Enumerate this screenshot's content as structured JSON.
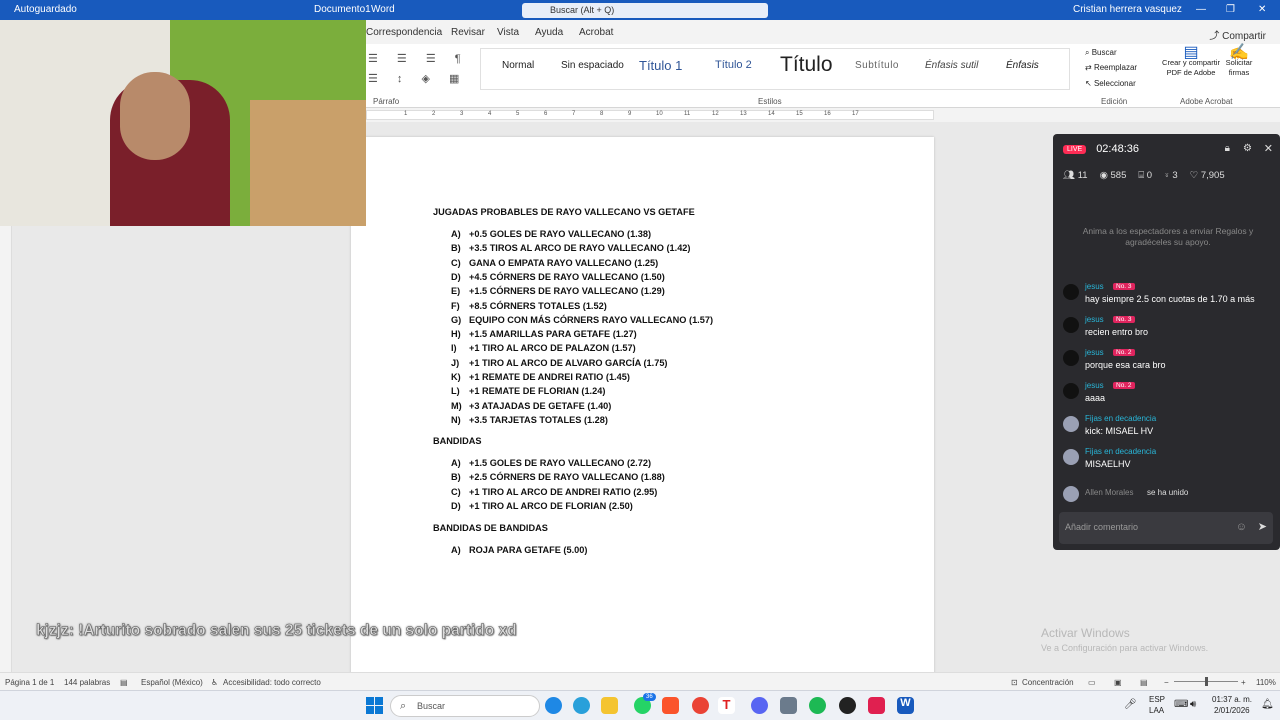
{
  "title_bar": {
    "autosave": "Autoguardado",
    "doc_name": "Documento1",
    "app": "Word",
    "search": "Buscar (Alt + Q)",
    "user": "Cristian herrera vasquez"
  },
  "ribbon_tabs": [
    "Correspondencia",
    "Revisar",
    "Vista",
    "Ayuda",
    "Acrobat"
  ],
  "share_label": "Compartir",
  "styles": [
    "Normal",
    "Sin espaciado",
    "Título 1",
    "Título 2",
    "Título",
    "Subtítulo",
    "Énfasis sutil",
    "Énfasis"
  ],
  "groups": {
    "parrafo": "Párrafo",
    "estilos": "Estilos",
    "edicion": "Edición",
    "adobe": "Adobe Acrobat"
  },
  "editing": {
    "buscar": "Buscar",
    "reemplazar": "Reemplazar",
    "seleccionar": "Seleccionar"
  },
  "adobe": {
    "create": "Crear y compartir PDF de Adobe",
    "sign": "Solicitar firmas"
  },
  "document": {
    "heading1": "JUGADAS PROBABLES DE RAYO VALLECANO VS GETAFE",
    "list1": [
      {
        "l": "A)",
        "t": "+0.5 GOLES DE RAYO VALLECANO (1.38)"
      },
      {
        "l": "B)",
        "t": "+3.5 TIROS AL ARCO DE RAYO VALLECANO (1.42)"
      },
      {
        "l": "C)",
        "t": "GANA O EMPATA RAYO VALLECANO (1.25)"
      },
      {
        "l": "D)",
        "t": "+4.5 CÓRNERS DE RAYO VALLECANO (1.50)"
      },
      {
        "l": "E)",
        "t": "+1.5 CÓRNERS DE RAYO VALLECANO (1.29)"
      },
      {
        "l": "F)",
        "t": "+8.5 CÓRNERS TOTALES (1.52)"
      },
      {
        "l": "G)",
        "t": "EQUIPO CON MÁS CÓRNERS RAYO VALLECANO (1.57)"
      },
      {
        "l": "H)",
        "t": "+1.5 AMARILLAS PARA GETAFE (1.27)"
      },
      {
        "l": "I)",
        "t": "+1 TIRO AL ARCO DE PALAZON (1.57)"
      },
      {
        "l": "J)",
        "t": "+1 TIRO AL ARCO DE ALVARO GARCÍA (1.75)"
      },
      {
        "l": "K)",
        "t": "+1 REMATE DE ANDREI RATIO (1.45)"
      },
      {
        "l": "L)",
        "t": "+1 REMATE DE FLORIAN (1.24)"
      },
      {
        "l": "M)",
        "t": "+3 ATAJADAS DE GETAFE (1.40)"
      },
      {
        "l": "N)",
        "t": "+3.5 TARJETAS TOTALES (1.28)"
      }
    ],
    "heading2": "BANDIDAS",
    "list2": [
      {
        "l": "A)",
        "t": "+1.5 GOLES DE RAYO VALLECANO (2.72)"
      },
      {
        "l": "B)",
        "t": "+2.5 CÓRNERS DE RAYO VALLECANO (1.88)"
      },
      {
        "l": "C)",
        "t": "+1 TIRO AL ARCO DE ANDREI RATIO (2.95)"
      },
      {
        "l": "D)",
        "t": "+1 TIRO AL ARCO DE FLORIAN (2.50)"
      }
    ],
    "heading3": "BANDIDAS DE BANDIDAS",
    "list3": [
      {
        "l": "A)",
        "t": "ROJA PARA GETAFE (5.00)"
      }
    ]
  },
  "live": {
    "badge": "LIVE",
    "timer": "02:48:36",
    "stats": [
      "11",
      "585",
      "0",
      "3",
      "7,905"
    ],
    "empty_text": "Anima a los espectadores a enviar Regalos y agradéceles su apoyo.",
    "messages": [
      {
        "user": "jesus",
        "rank": "No. 3",
        "text": "hay siempre 2.5 con cuotas de 1.70 a más"
      },
      {
        "user": "jesus",
        "rank": "No. 3",
        "text": "recien entro bro"
      },
      {
        "user": "jesus",
        "rank": "No. 2",
        "text": "porque esa cara bro"
      },
      {
        "user": "jesus",
        "rank": "No. 2",
        "text": "aaaa"
      },
      {
        "user": "Fijas en decadencia",
        "rank": "",
        "text": "kick: MISAEL HV"
      },
      {
        "user": "Fijas en decadencia",
        "rank": "",
        "text": "MISAELHV"
      }
    ],
    "join_user": "Allen Morales",
    "join_text": "se ha unido",
    "comment_placeholder": "Añadir comentario"
  },
  "chat_overlay": "kjzjz: !Arturito sobrado salen sus 25 tickets de un solo partido xd",
  "activate": {
    "title": "Activar Windows",
    "sub": "Ve a Configuración para activar Windows."
  },
  "status_bar": {
    "page": "Página 1 de 1",
    "words": "144 palabras",
    "lang": "Español (México)",
    "access": "Accesibilidad: todo correcto",
    "focus": "Concentración",
    "zoom": "110%"
  },
  "taskbar": {
    "search": "Buscar",
    "badge": "36",
    "lang1": "ESP",
    "lang2": "LAA",
    "time": "01:37 a. m.",
    "date": "2/01/2026"
  }
}
